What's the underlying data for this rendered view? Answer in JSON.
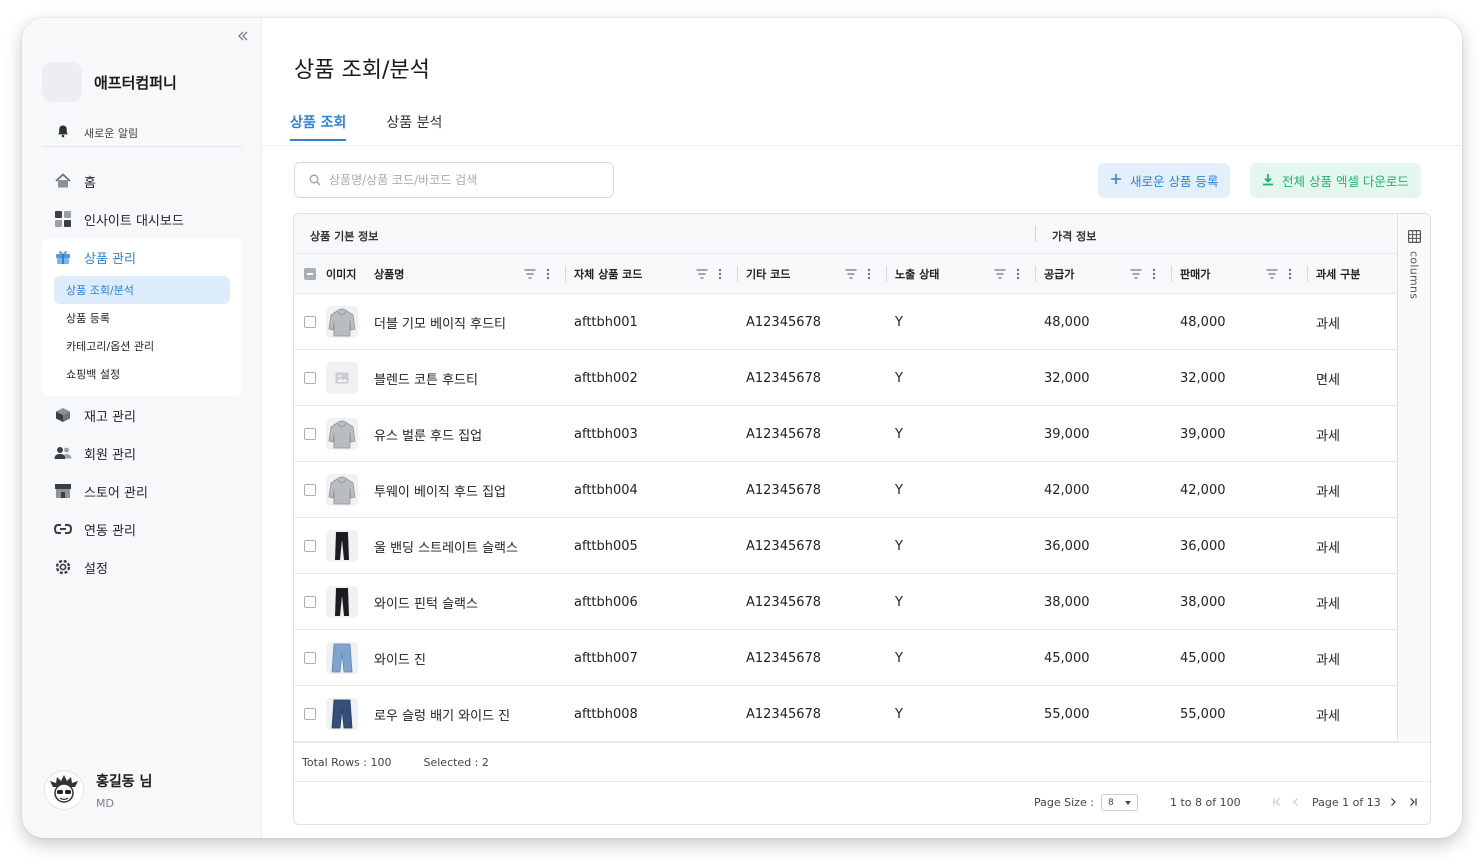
{
  "sidebar": {
    "company_name": "애프터컴퍼니",
    "notification_label": "새로운 알림",
    "nav": [
      {
        "label": "홈",
        "icon": "home-icon"
      },
      {
        "label": "인사이트 대시보드",
        "icon": "dashboard-icon"
      },
      {
        "label": "상품 관리",
        "icon": "gift-icon",
        "active": true,
        "sub": [
          {
            "label": "상품 조회/분석",
            "active": true
          },
          {
            "label": "상품 등록"
          },
          {
            "label": "카테고리/옵션 관리"
          },
          {
            "label": "쇼핑백 설정"
          }
        ]
      },
      {
        "label": "재고 관리",
        "icon": "box-icon"
      },
      {
        "label": "회원 관리",
        "icon": "users-icon"
      },
      {
        "label": "스토어 관리",
        "icon": "store-icon"
      },
      {
        "label": "연동 관리",
        "icon": "link-icon"
      },
      {
        "label": "설정",
        "icon": "gear-icon"
      }
    ],
    "user": {
      "name": "홍길동 님",
      "role": "MD"
    }
  },
  "main": {
    "title": "상품 조회/분석",
    "tabs": [
      {
        "label": "상품 조회",
        "active": true
      },
      {
        "label": "상품 분석"
      }
    ],
    "search_placeholder": "상품명/상품 코드/바코드 검색",
    "btn_new": "새로운 상품 등록",
    "btn_excel": "전체 상품 엑셀 다운로드"
  },
  "grid": {
    "group_basic": "상품 기본 정보",
    "group_price": "가격 정보",
    "columns": {
      "image": "이미지",
      "name": "상품명",
      "code": "자체 상품 코드",
      "other_code": "기타 코드",
      "status": "노출 상태",
      "supply": "공급가",
      "sale": "판매가",
      "tax": "과세 구분"
    },
    "columns_panel_label": "columns",
    "rows": [
      {
        "name": "더블 기모 베이직 후드티",
        "code": "afttbh001",
        "other_code": "A12345678",
        "status": "Y",
        "supply": "48,000",
        "sale": "48,000",
        "tax": "과세",
        "thumb": "hoodie"
      },
      {
        "name": "블렌드 코튼 후드티",
        "code": "afttbh002",
        "other_code": "A12345678",
        "status": "Y",
        "supply": "32,000",
        "sale": "32,000",
        "tax": "면세",
        "thumb": "placeholder"
      },
      {
        "name": "유스 벌룬 후드 집업",
        "code": "afttbh003",
        "other_code": "A12345678",
        "status": "Y",
        "supply": "39,000",
        "sale": "39,000",
        "tax": "과세",
        "thumb": "hoodie"
      },
      {
        "name": "투웨이 베이직 후드 집업",
        "code": "afttbh004",
        "other_code": "A12345678",
        "status": "Y",
        "supply": "42,000",
        "sale": "42,000",
        "tax": "과세",
        "thumb": "hoodie"
      },
      {
        "name": "울 밴딩 스트레이트 슬랙스",
        "code": "afttbh005",
        "other_code": "A12345678",
        "status": "Y",
        "supply": "36,000",
        "sale": "36,000",
        "tax": "과세",
        "thumb": "slacks"
      },
      {
        "name": "와이드 핀턱 슬랙스",
        "code": "afttbh006",
        "other_code": "A12345678",
        "status": "Y",
        "supply": "38,000",
        "sale": "38,000",
        "tax": "과세",
        "thumb": "slacks"
      },
      {
        "name": "와이드 진",
        "code": "afttbh007",
        "other_code": "A12345678",
        "status": "Y",
        "supply": "45,000",
        "sale": "45,000",
        "tax": "과세",
        "thumb": "jeans-light"
      },
      {
        "name": "로우 슬렁 배기 와이드 진",
        "code": "afttbh008",
        "other_code": "A12345678",
        "status": "Y",
        "supply": "55,000",
        "sale": "55,000",
        "tax": "과세",
        "thumb": "jeans-dark"
      }
    ],
    "status_bar": {
      "total": "Total Rows : 100",
      "selected": "Selected : 2"
    },
    "pager": {
      "page_size_label": "Page Size :",
      "page_size": "8",
      "range": "1 to 8 of 100",
      "page": "Page 1 of 13"
    }
  },
  "colors": {
    "accent": "#2f83d6",
    "accent_bg": "#e3f0fc",
    "green": "#23b06b",
    "green_bg": "#e4f7ee"
  }
}
